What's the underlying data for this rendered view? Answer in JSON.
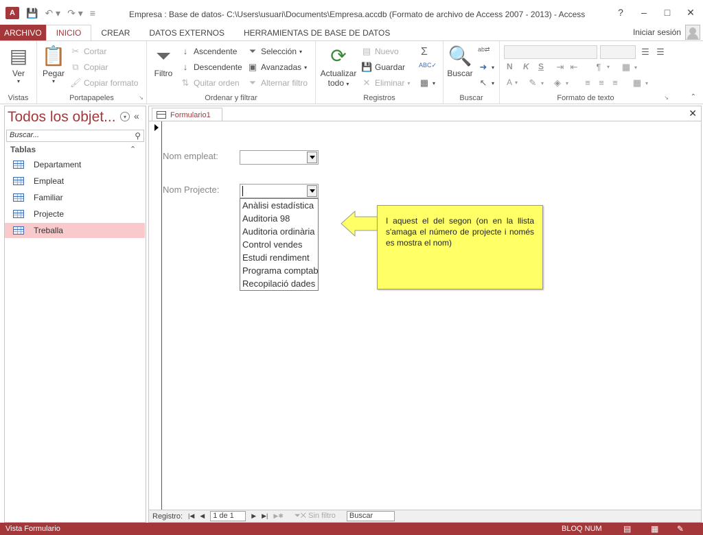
{
  "window": {
    "title": "Empresa : Base de datos- C:\\Users\\usuari\\Documents\\Empresa.accdb (Formato de archivo de Access 2007 - 2013) - Access",
    "app_logo": "A",
    "controls": {
      "help": "?",
      "minimize": "–",
      "maximize": "□",
      "close": "✕"
    }
  },
  "ribbon_tabs": {
    "file": "ARCHIVO",
    "tabs": [
      "INICIO",
      "CREAR",
      "DATOS EXTERNOS",
      "HERRAMIENTAS DE BASE DE DATOS"
    ],
    "active": "INICIO",
    "signin": "Iniciar sesión"
  },
  "ribbon": {
    "views": {
      "ver": "Ver",
      "label": "Vistas"
    },
    "clipboard": {
      "paste": "Pegar",
      "cut": "Cortar",
      "copy": "Copiar",
      "format_painter": "Copiar formato",
      "label": "Portapapeles"
    },
    "sort_filter": {
      "filter": "Filtro",
      "ascending": "Ascendente",
      "descending": "Descendente",
      "remove_sort": "Quitar orden",
      "selection": "Selección",
      "advanced": "Avanzadas",
      "toggle_filter": "Alternar filtro",
      "label": "Ordenar y filtrar"
    },
    "records": {
      "refresh": "Actualizar",
      "refresh2": "todo",
      "new": "Nuevo",
      "save": "Guardar",
      "delete": "Eliminar",
      "label": "Registros"
    },
    "find": {
      "find": "Buscar",
      "label": "Buscar"
    },
    "text_format": {
      "bold": "N",
      "italic": "K",
      "underline": "S",
      "font_color": "A",
      "label": "Formato de texto"
    }
  },
  "nav_pane": {
    "title": "Todos los objet...",
    "search_placeholder": "Buscar...",
    "group": "Tablas",
    "items": [
      "Departament",
      "Empleat",
      "Familiar",
      "Projecte",
      "Treballa"
    ],
    "selected": "Treballa"
  },
  "document": {
    "tab": "Formulario1",
    "form": {
      "employee_label": "Nom empleat:",
      "project_label": "Nom Projecte:",
      "project_options": [
        "Anàlisi estadística",
        "Auditoria 98",
        "Auditoria ordinària",
        "Control vendes",
        "Estudi rendiment",
        "Programa comptable",
        "Recopilació dades"
      ]
    },
    "callout": "I aquest el del segon (on en la llista s'amaga el número de projecte i només es mostra el nom)",
    "record_nav": {
      "label": "Registro:",
      "current": "1 de 1",
      "no_filter": "Sin filtro",
      "search": "Buscar"
    }
  },
  "status_bar": {
    "left": "Vista Formulario",
    "num_lock": "BLOQ NUM"
  },
  "colors": {
    "accent": "#a4373a",
    "callout": "#ffff66",
    "selected_item": "#f9c9cb"
  }
}
